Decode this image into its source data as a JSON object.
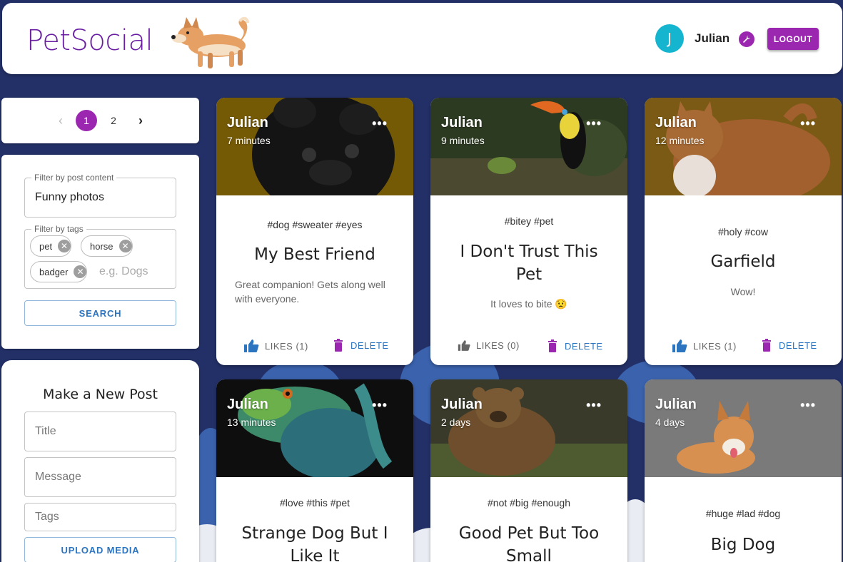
{
  "app": {
    "brand": "PetSocial"
  },
  "header": {
    "avatar_initial": "J",
    "user_name": "Julian",
    "logout_label": "LOGOUT"
  },
  "pagination": {
    "pages": [
      "1",
      "2"
    ],
    "current": "1"
  },
  "filters": {
    "content_label": "Filter by post content",
    "content_value": "Funny photos",
    "tags_label": "Filter by tags",
    "tags": [
      "pet",
      "horse",
      "badger"
    ],
    "tags_placeholder": "e.g. Dogs",
    "search_label": "SEARCH"
  },
  "new_post": {
    "heading": "Make a New Post",
    "title_placeholder": "Title",
    "message_placeholder": "Message",
    "tags_placeholder": "Tags",
    "upload_label": "UPLOAD MEDIA"
  },
  "posts": [
    {
      "author": "Julian",
      "time": "7 minutes",
      "tags": "#dog #sweater #eyes",
      "title": "My Best Friend",
      "message": "Great companion! Gets along well with everyone.",
      "likes": "LIKES (1)",
      "delete": "DELETE",
      "liked": true
    },
    {
      "author": "Julian",
      "time": "9 minutes",
      "tags": "#bitey #pet",
      "title": "I Don't Trust This Pet",
      "message": "It loves to bite 😟",
      "likes": "LIKES (0)",
      "delete": "DELETE",
      "liked": false
    },
    {
      "author": "Julian",
      "time": "12 minutes",
      "tags": "#holy #cow",
      "title": "Garfield",
      "message": "Wow!",
      "likes": "LIKES (1)",
      "delete": "DELETE",
      "liked": true
    },
    {
      "author": "Julian",
      "time": "13 minutes",
      "tags": "#love #this #pet",
      "title": "Strange Dog But I Like It"
    },
    {
      "author": "Julian",
      "time": "2 days",
      "tags": "#not #big #enough",
      "title": "Good Pet But Too Small"
    },
    {
      "author": "Julian",
      "time": "4 days",
      "tags": "#huge #lad #dog",
      "title": "Big Dog"
    }
  ],
  "colors": {
    "accent": "#9b27b0",
    "background": "#233067",
    "link": "#2b74c0",
    "like": "#2b74c0"
  }
}
